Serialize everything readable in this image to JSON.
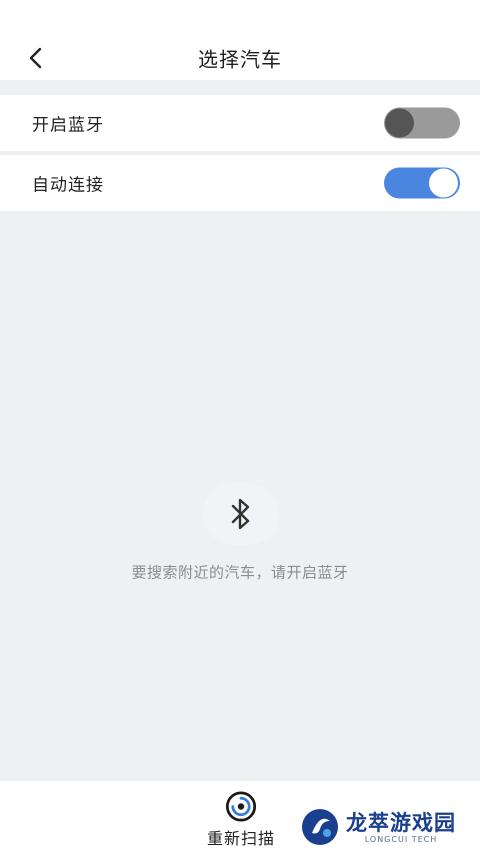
{
  "header": {
    "title": "选择汽车",
    "back_icon": "chevron-left-icon"
  },
  "settings": [
    {
      "label": "开启蓝牙",
      "state": "off"
    },
    {
      "label": "自动连接",
      "state": "on"
    }
  ],
  "empty_state": {
    "icon": "bluetooth-icon",
    "message": "要搜索附近的汽车，请开启蓝牙"
  },
  "bottom_bar": {
    "rescan_label": "重新扫描",
    "rescan_icon": "radar-scan-icon"
  },
  "watermark": {
    "text": "龙萃游戏园",
    "subtext": "LONGCUI TECH"
  },
  "colors": {
    "toggle_on": "#4a86e0",
    "toggle_off": "#9a9a9a",
    "watermark": "#1b3f8f"
  }
}
